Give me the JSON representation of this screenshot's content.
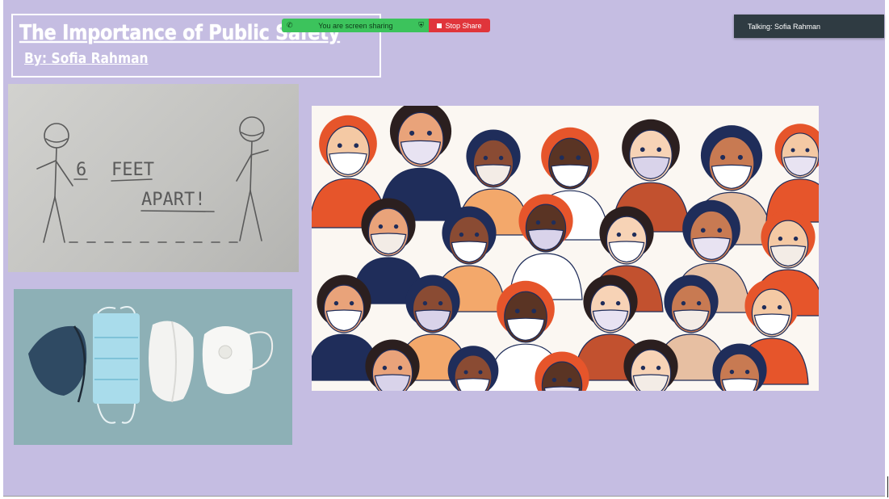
{
  "slide": {
    "title": "The Importance of Public Safety",
    "subtitle": "By: Sofia Rahman",
    "sketch_text": {
      "number": "6",
      "line1": "FEET",
      "line2": "APART!"
    }
  },
  "share_bar": {
    "status": "You are screen sharing",
    "stop_label": "Stop Share"
  },
  "talking_indicator": {
    "text": "Talking: Sofia Rahman"
  },
  "colors": {
    "slide_bg": "#c5bde2",
    "share_green": "#3cc35c",
    "stop_red": "#e0353b",
    "talk_bg": "#2f3b42"
  }
}
